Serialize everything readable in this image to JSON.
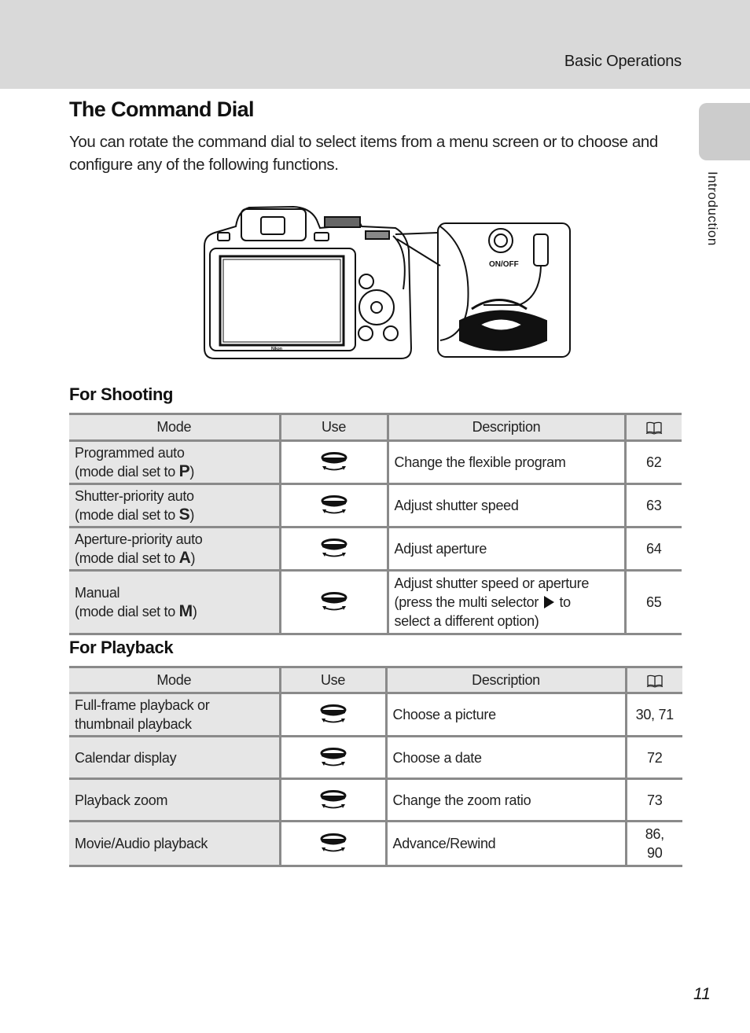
{
  "header": {
    "section": "Basic Operations"
  },
  "side_tab": {
    "label": "Introduction"
  },
  "title": "The Command Dial",
  "intro": "You can rotate the command dial to select items from a menu screen or to choose and configure any of the following functions.",
  "figure": {
    "description": "Camera rear view with callout of command dial rotation",
    "callout_label": "ON/OFF",
    "brand_mark": "Nikon"
  },
  "shooting": {
    "heading": "For Shooting",
    "columns": [
      "Mode",
      "Use",
      "Description",
      "book-reference-icon"
    ],
    "rows": [
      {
        "mode_line1": "Programmed auto",
        "mode_line2": "(mode dial set to ",
        "mode_letter": "P",
        "mode_close": ")",
        "use_icon": "command-dial-icon",
        "description": "Change the flexible program",
        "ref": "62"
      },
      {
        "mode_line1": "Shutter-priority auto",
        "mode_line2": "(mode dial set to ",
        "mode_letter": "S",
        "mode_close": ")",
        "use_icon": "command-dial-icon",
        "description": "Adjust shutter speed",
        "ref": "63"
      },
      {
        "mode_line1": "Aperture-priority auto",
        "mode_line2": "(mode dial set to ",
        "mode_letter": "A",
        "mode_close": ")",
        "use_icon": "command-dial-icon",
        "description": "Adjust aperture",
        "ref": "64"
      },
      {
        "mode_line1": "Manual",
        "mode_line2": "(mode dial set to ",
        "mode_letter": "M",
        "mode_close": ")",
        "use_icon": "command-dial-icon",
        "description_line1": "Adjust shutter speed or aperture",
        "description_line2a": "(press the multi selector ",
        "description_line2b": " to",
        "description_line3": "select a different option)",
        "ref": "65"
      }
    ]
  },
  "playback": {
    "heading": "For Playback",
    "columns": [
      "Mode",
      "Use",
      "Description",
      "book-reference-icon"
    ],
    "rows": [
      {
        "mode_line1": "Full-frame playback or",
        "mode_line2": "thumbnail playback",
        "use_icon": "command-dial-icon",
        "description": "Choose a picture",
        "ref": "30, 71"
      },
      {
        "mode": "Calendar display",
        "use_icon": "command-dial-icon",
        "description": "Choose a date",
        "ref": "72"
      },
      {
        "mode": "Playback zoom",
        "use_icon": "command-dial-icon",
        "description": "Change the zoom ratio",
        "ref": "73"
      },
      {
        "mode": "Movie/Audio playback",
        "use_icon": "command-dial-icon",
        "description": "Advance/Rewind",
        "ref_line1": "86,",
        "ref_line2": "90"
      }
    ]
  },
  "page_number": "11"
}
